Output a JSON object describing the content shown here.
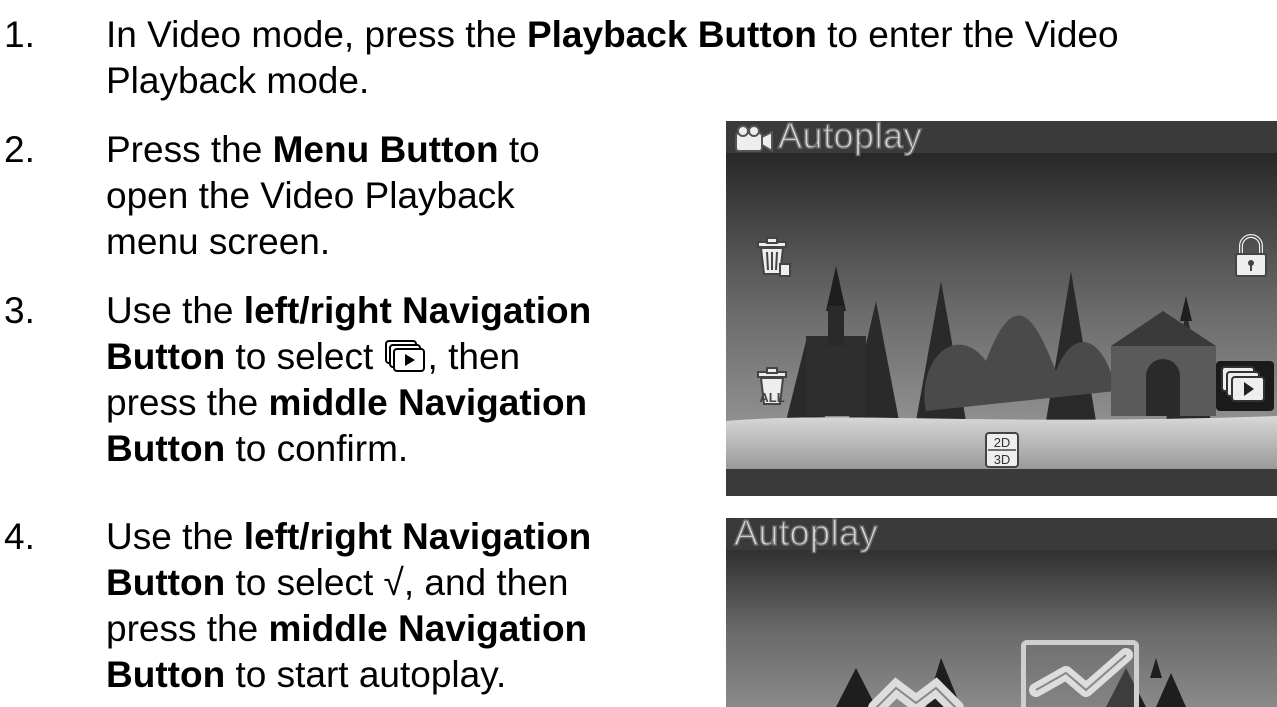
{
  "steps": [
    {
      "number": "1.",
      "lines": [
        [
          "In Video mode, press the ",
          "Playback Button",
          " to enter the Video"
        ],
        [
          "Playback mode."
        ]
      ]
    },
    {
      "number": "2.",
      "lines": [
        [
          "Press the ",
          "Menu Button",
          " to"
        ],
        [
          "open the Video Playback"
        ],
        [
          "menu screen."
        ]
      ]
    },
    {
      "number": "3.",
      "line1_pre": "Use the ",
      "line1_bold": "left/right Navigation",
      "line2_bold": "Button",
      "line2_pre": " to select ",
      "line2_post": ", then",
      "line3_pre": "press the ",
      "line3_bold": "middle Navigation",
      "line4_bold": "Button",
      "line4_post": " to confirm."
    },
    {
      "number": "4.",
      "line1_pre": "Use the ",
      "line1_bold": "left/right Navigation",
      "line2_bold": "Button",
      "line2_post": " to select √, and then",
      "line3_pre": "press the ",
      "line3_bold": "middle Navigation",
      "line4_bold": "Button",
      "line4_post": " to start autoplay."
    }
  ],
  "screen1": {
    "title": "Autoplay",
    "badge": "2D\n3D",
    "badge_top": "2D",
    "badge_bottom": "3D"
  },
  "screen2": {
    "title": "Autoplay"
  },
  "icons": [
    "video-camera-icon",
    "trash-icon",
    "trash-all-icon",
    "lock-icon",
    "slideshow-icon",
    "2d-3d-icon",
    "cancel-x-icon",
    "confirm-check-icon"
  ]
}
